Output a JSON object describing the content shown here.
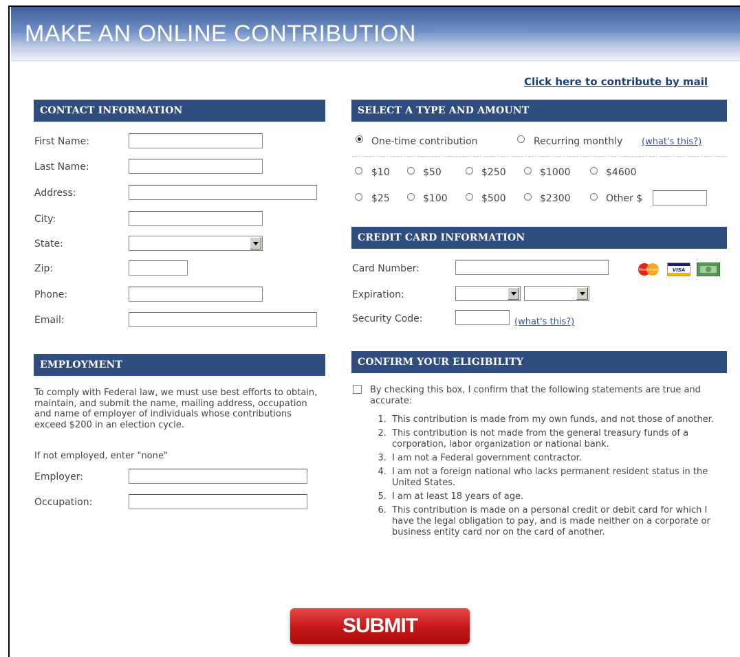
{
  "banner": {
    "title": "MAKE AN ONLINE CONTRIBUTION"
  },
  "mail_link": "Click here to contribute by mail",
  "contact": {
    "header": "CONTACT INFORMATION",
    "first_name": "First Name:",
    "last_name": "Last Name:",
    "address": "Address:",
    "city": "City:",
    "state": "State:",
    "zip": "Zip:",
    "phone": "Phone:",
    "email": "Email:"
  },
  "amount": {
    "header": "SELECT A TYPE AND AMOUNT",
    "one_time": "One-time contribution",
    "recurring": "Recurring monthly",
    "whats_this": "(what's this?)",
    "selected_type": "One-time contribution",
    "options_row1": [
      "$10",
      "$50",
      "$250",
      "$1000",
      "$4600"
    ],
    "options_row2": [
      "$25",
      "$100",
      "$500",
      "$2300"
    ],
    "other": "Other $"
  },
  "credit": {
    "header": "CREDIT CARD INFORMATION",
    "card_number": "Card Number:",
    "expiration": "Expiration:",
    "security_code": "Security Code:",
    "whats_this": "(what's this?)",
    "card_icons": [
      "mastercard-icon",
      "visa-icon",
      "cash-card-icon"
    ],
    "mastercard_text": "MasterCard",
    "visa_text": "VISA"
  },
  "employment": {
    "header": "EMPLOYMENT",
    "notice": "To comply with Federal law, we must use best efforts to obtain, maintain, and submit the name, mailing address, occupation and name of employer of individuals whose contributions exceed $200 in an election cycle.",
    "not_employed": "If not employed, enter \"none\"",
    "employer": "Employer:",
    "occupation": "Occupation:"
  },
  "eligibility": {
    "header": "CONFIRM YOUR ELIGIBILITY",
    "checkbox_text": "By checking this box, I confirm that the following statements are true and accurate:",
    "checked": false,
    "statements": [
      "This contribution is made from my own funds, and not those of another.",
      "This contribution is not made from the general treasury funds of a corporation, labor organization or national bank.",
      "I am not a Federal government contractor.",
      "I am not a foreign national who lacks permanent resident status in the United States.",
      "I am at least 18 years of age.",
      "This contribution is made on a personal credit or debit card for which I have the legal obligation to pay, and is made neither on a corporate or business entity card nor on the card of another."
    ]
  },
  "submit_label": "SUBMIT",
  "colors": {
    "section_header": "#2f4d7e",
    "link": "#1a3f7a",
    "submit": "#c81a1a"
  }
}
